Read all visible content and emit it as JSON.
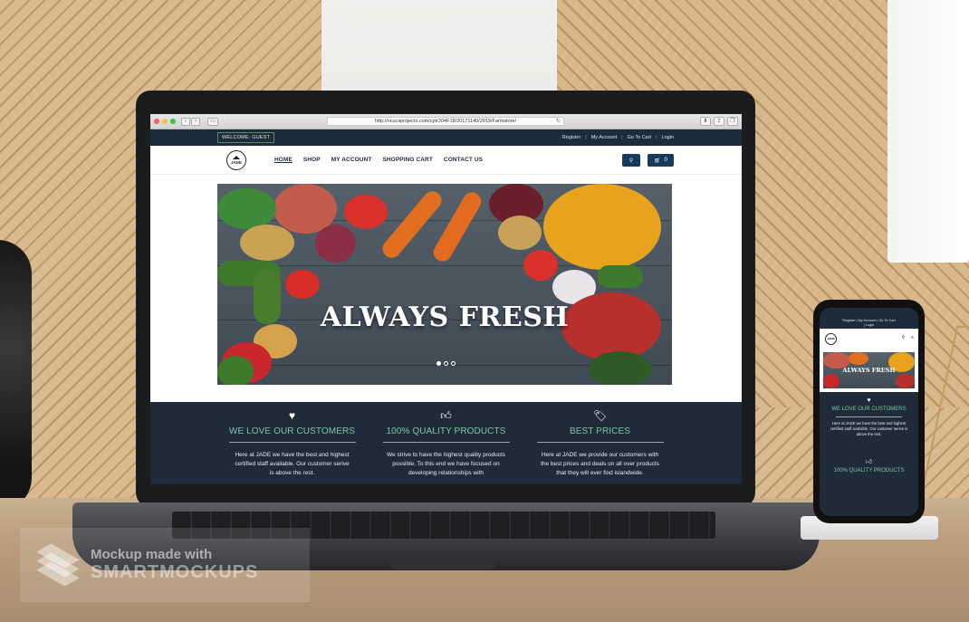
{
  "browser": {
    "url": "http://ncucsprojects.com/cptr204F18/20171140/2019/Farmstore/"
  },
  "topbar": {
    "welcome": "WELCOME: GUEST",
    "links": [
      "Register",
      "My Account",
      "Go To Cart",
      "Login"
    ]
  },
  "logo": {
    "text": "JADE"
  },
  "nav": {
    "items": [
      "HOME",
      "SHOP",
      "MY ACCOUNT",
      "SHOPPING CART",
      "CONTACT US"
    ],
    "active": "HOME",
    "cart_count": "0"
  },
  "hero": {
    "title": "ALWAYS FRESH",
    "slides": 3,
    "active_slide": 1
  },
  "features": [
    {
      "icon": "heart-icon",
      "title": "WE LOVE OUR CUSTOMERS",
      "text": "Here at JADE we have the best and highest certified staff available. Our customer serive is above the rest."
    },
    {
      "icon": "thumbs-up-icon",
      "title": "100% QUALITY PRODUCTS",
      "text": "We strive to have the highest quality products possible. To this end we have focused on developing relationships with"
    },
    {
      "icon": "tag-icon",
      "title": "BEST PRICES",
      "text": "Here at JADE we provide our customers with the best prices and deals on all over products that they will ever find islandwide."
    }
  ],
  "phone": {
    "top_links": [
      "Register",
      "My Account",
      "Go To Cart",
      "Login"
    ],
    "hero_title": "ALWAYS FRESH",
    "feature1_title": "WE LOVE OUR CUSTOMERS",
    "feature1_text": "Here at JADE we have the best and highest certified staff available. Our customer serive is above the rest.",
    "feature2_title": "100% QUALITY PRODUCTS"
  },
  "watermark": {
    "line1": "Mockup made with",
    "line2": "SMARTMOCKUPS"
  },
  "colors": {
    "site_dark": "#1d2b3a",
    "accent_green": "#7fc4a8",
    "button_blue": "#17395a"
  }
}
